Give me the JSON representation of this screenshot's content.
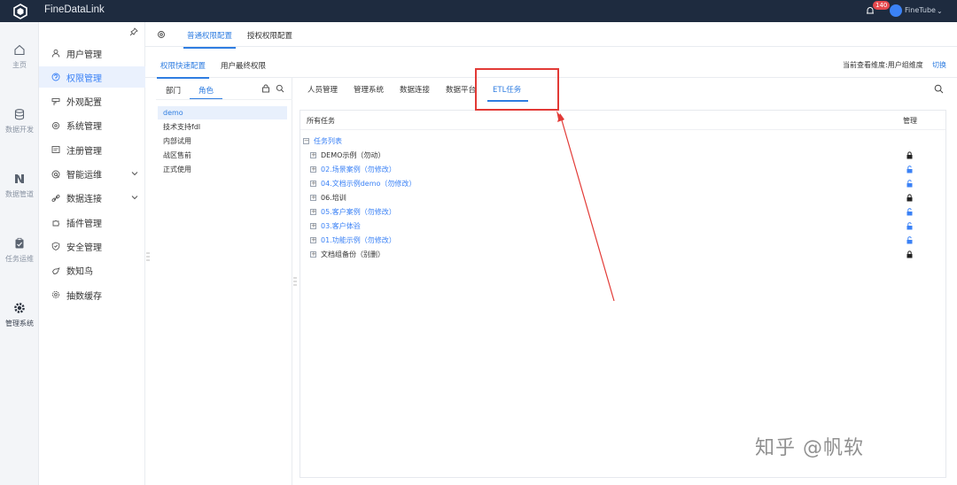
{
  "app": {
    "title": "FineDataLink",
    "notification_count": "140",
    "user_name": "FineTube"
  },
  "rail": [
    {
      "label": "主页",
      "icon": "home-icon"
    },
    {
      "label": "数据开发",
      "icon": "database-icon"
    },
    {
      "label": "数据管道",
      "icon": "pipeline-icon"
    },
    {
      "label": "任务运维",
      "icon": "clipboard-icon"
    },
    {
      "label": "管理系统",
      "icon": "settings-icon",
      "active": true
    }
  ],
  "sidebar": {
    "items": [
      {
        "label": "用户管理",
        "icon": "user-icon"
      },
      {
        "label": "权限管理",
        "icon": "permission-icon",
        "active": true
      },
      {
        "label": "外观配置",
        "icon": "appearance-icon"
      },
      {
        "label": "系统管理",
        "icon": "gear-icon"
      },
      {
        "label": "注册管理",
        "icon": "register-icon"
      },
      {
        "label": "智能运维",
        "icon": "ops-icon",
        "expandable": true
      },
      {
        "label": "数据连接",
        "icon": "link-icon",
        "expandable": true
      },
      {
        "label": "插件管理",
        "icon": "plugin-icon"
      },
      {
        "label": "安全管理",
        "icon": "shield-icon"
      },
      {
        "label": "数知鸟",
        "icon": "bird-icon"
      },
      {
        "label": "抽数缓存",
        "icon": "cache-icon"
      }
    ]
  },
  "top_tabs": [
    {
      "label": "普通权限配置",
      "active": true
    },
    {
      "label": "授权权限配置"
    }
  ],
  "sub_tabs": [
    {
      "label": "权限快速配置",
      "active": true
    },
    {
      "label": "用户最终权限"
    }
  ],
  "dimension": {
    "hint": "当前查看维度:用户组维度",
    "switch_label": "切换"
  },
  "role_panel": {
    "tabs": [
      {
        "label": "部门"
      },
      {
        "label": "角色",
        "active": true
      }
    ],
    "roles": [
      {
        "label": "demo",
        "selected": true
      },
      {
        "label": "技术支持fdl"
      },
      {
        "label": "内部试用"
      },
      {
        "label": "战区售前"
      },
      {
        "label": "正式使用"
      }
    ]
  },
  "category_tabs": [
    {
      "label": "人员管理"
    },
    {
      "label": "管理系统"
    },
    {
      "label": "数据连接"
    },
    {
      "label": "数据平台"
    },
    {
      "label": "ETL任务",
      "active": true
    }
  ],
  "table": {
    "col_tasks": "所有任务",
    "col_manage": "管理",
    "root": {
      "label": "任务列表",
      "toggle": "−"
    },
    "rows": [
      {
        "label": "DEMO示例（勿动）",
        "toggle": "+",
        "color": "#333333",
        "locked": true
      },
      {
        "label": "02.场景案例（勿修改）",
        "toggle": "+",
        "color": "#3b82f6",
        "locked": false
      },
      {
        "label": "04.文档示例demo（勿修改）",
        "toggle": "+",
        "color": "#3b82f6",
        "locked": false
      },
      {
        "label": "06.培训",
        "toggle": "+",
        "color": "#333333",
        "locked": true
      },
      {
        "label": "05.客户案例（勿修改）",
        "toggle": "+",
        "color": "#3b82f6",
        "locked": false
      },
      {
        "label": "03.客户体验",
        "toggle": "+",
        "color": "#3b82f6",
        "locked": false
      },
      {
        "label": "01.功能示例（勿修改）",
        "toggle": "+",
        "color": "#3b82f6",
        "locked": false
      },
      {
        "label": "文档组备份（别删）",
        "toggle": "+",
        "color": "#333333",
        "locked": true
      }
    ]
  },
  "watermark": "知乎 @帆软",
  "colors": {
    "accent": "#2f7de1",
    "annotation": "#e23a36",
    "topbar": "#1e2b3f"
  }
}
